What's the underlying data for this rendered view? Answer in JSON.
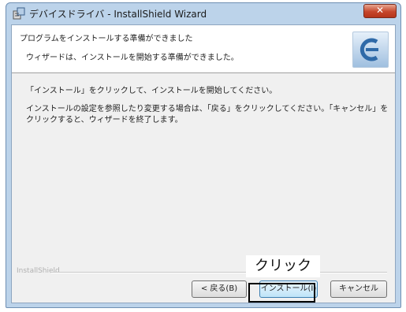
{
  "window": {
    "title": "デバイスドライバ - InstallShield Wizard",
    "close_label": "✕"
  },
  "header": {
    "title": "プログラムをインストールする準備ができました",
    "subtitle": "ウィザードは、インストールを開始する準備ができました。"
  },
  "body": {
    "line1": "「インストール」をクリックして、インストールを開始してください。",
    "line2": "インストールの設定を参照したり変更する場合は、「戻る」をクリックしてください。「キャンセル」をクリックすると、ウィザードを終了します。"
  },
  "footer": {
    "brand": "InstallShield",
    "back_label": "< 戻る(B)",
    "install_label": "インストール(I)",
    "cancel_label": "キャンセル"
  },
  "annotation": {
    "label": "クリック"
  },
  "colors": {
    "frame": "#bcd3ea",
    "close": "#c6462b",
    "highlight": "#000000"
  },
  "icons": {
    "app": "installer-icon",
    "logo": "installshield-logo-icon"
  }
}
